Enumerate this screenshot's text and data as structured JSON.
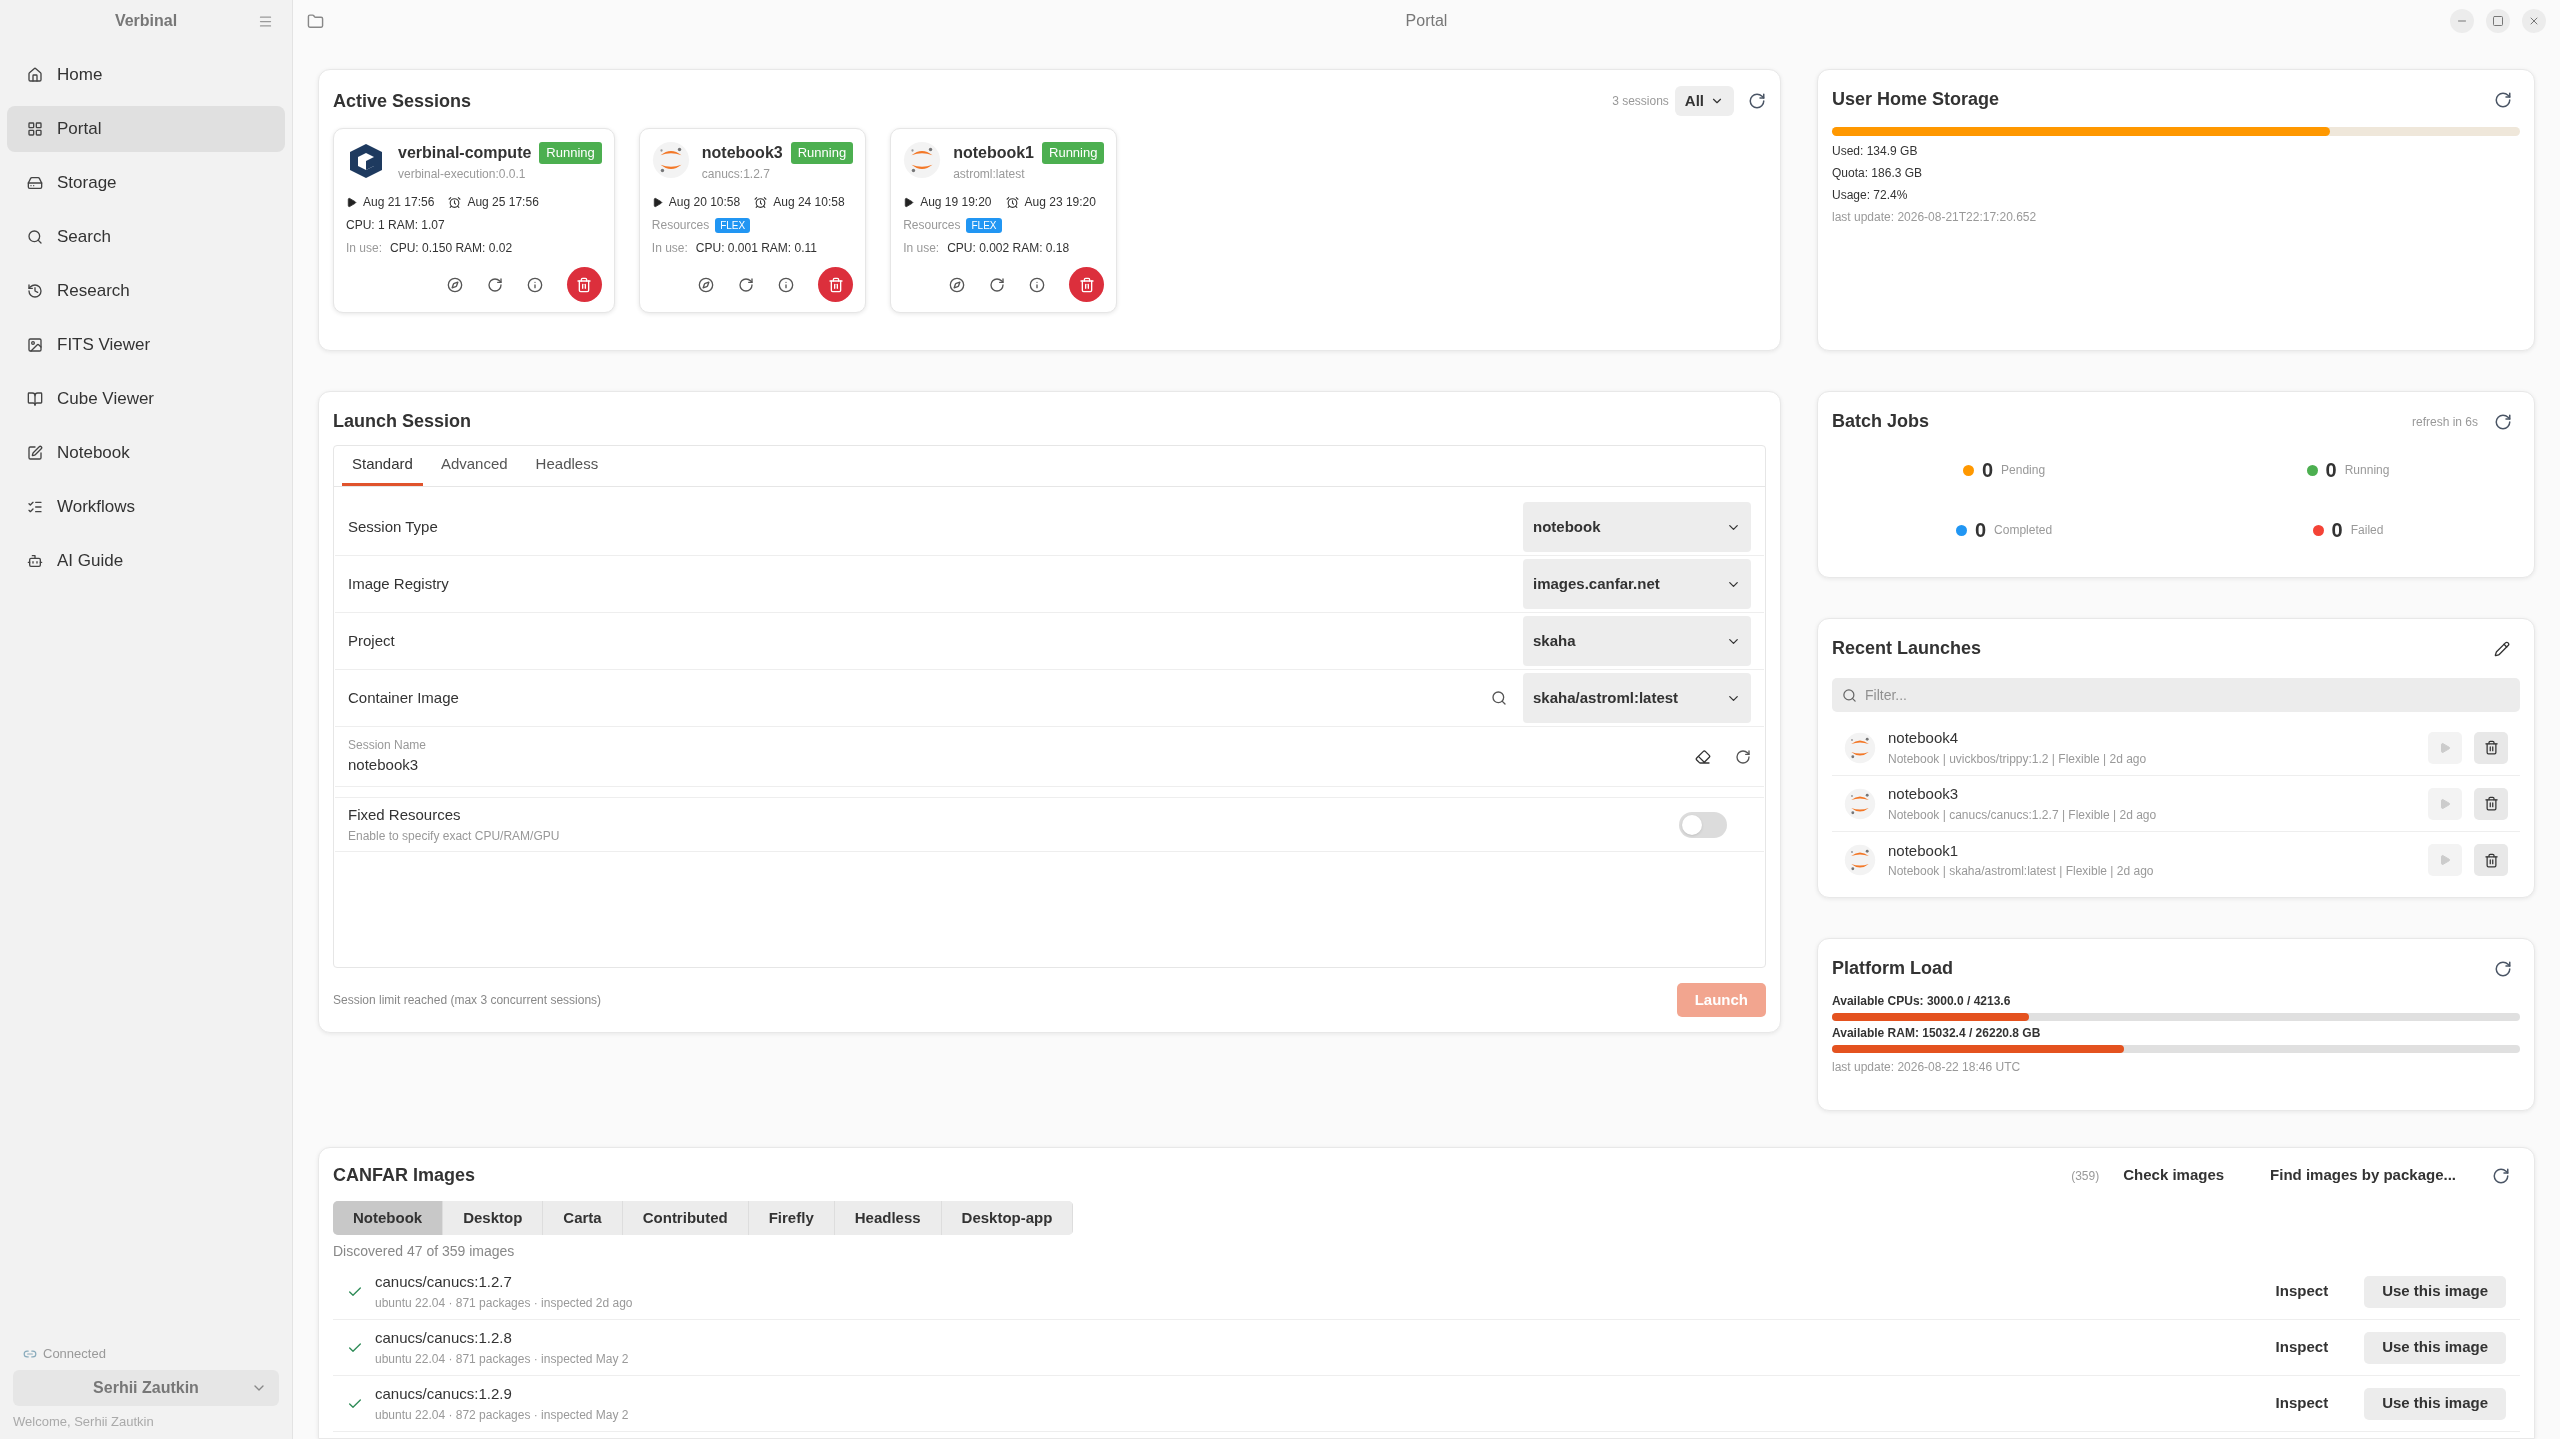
{
  "app": {
    "name": "Verbinal",
    "connection": "Connected",
    "user": "Serhii Zautkin",
    "welcome": "Welcome, Serhii Zautkin"
  },
  "window": {
    "title": "Portal"
  },
  "sidebar": {
    "items": [
      {
        "label": "Home",
        "selected": false
      },
      {
        "label": "Portal",
        "selected": true
      },
      {
        "label": "Storage",
        "selected": false
      },
      {
        "label": "Search",
        "selected": false
      },
      {
        "label": "Research",
        "selected": false
      },
      {
        "label": "FITS Viewer",
        "selected": false
      },
      {
        "label": "Cube Viewer",
        "selected": false
      },
      {
        "label": "Notebook",
        "selected": false
      },
      {
        "label": "Workflows",
        "selected": false
      },
      {
        "label": "AI Guide",
        "selected": false
      }
    ]
  },
  "active_sessions": {
    "title": "Active Sessions",
    "count": "3 sessions",
    "filter": "All",
    "sessions": [
      {
        "name": "verbinal-compute",
        "kind": "cube",
        "status": "Running",
        "image": "verbinal-execution:0.0.1",
        "start": "Aug 21 17:56",
        "end": "Aug 25 17:56",
        "resources": "CPU: 1  RAM: 1.07",
        "usage_label": "In use:",
        "usage": "CPU: 0.150  RAM: 0.02"
      },
      {
        "name": "notebook3",
        "kind": "jupyter",
        "status": "Running",
        "image": "canucs:1.2.7",
        "start": "Aug 20 10:58",
        "end": "Aug 24 10:58",
        "resources_label": "Resources",
        "resources_badge": "FLEX",
        "usage_label": "In use:",
        "usage": "CPU: 0.001  RAM: 0.11"
      },
      {
        "name": "notebook1",
        "kind": "jupyter",
        "status": "Running",
        "image": "astroml:latest",
        "start": "Aug 19 19:20",
        "end": "Aug 23 19:20",
        "resources_label": "Resources",
        "resources_badge": "FLEX",
        "usage_label": "In use:",
        "usage": "CPU: 0.002  RAM: 0.18"
      }
    ]
  },
  "launch_session": {
    "title": "Launch Session",
    "tabs": [
      {
        "label": "Standard",
        "selected": true
      },
      {
        "label": "Advanced",
        "selected": false
      },
      {
        "label": "Headless",
        "selected": false
      }
    ],
    "fields": [
      {
        "label": "Session Type",
        "value": "notebook",
        "kind": "select"
      },
      {
        "label": "Image Registry",
        "value": "images.canfar.net",
        "kind": "select"
      },
      {
        "label": "Project",
        "value": "skaha",
        "kind": "select"
      },
      {
        "label": "Container Image",
        "value": "skaha/astroml:latest",
        "kind": "search"
      }
    ],
    "session_name": {
      "label": "Session Name",
      "value": "notebook3"
    },
    "fixed_resources": {
      "label": "Fixed Resources",
      "hint": "Enable to specify exact CPU/RAM/GPU",
      "on": false
    },
    "limit_note": "Session limit reached (max 3 concurrent sessions)",
    "launch_button": {
      "label": "Launch",
      "disabled": true
    }
  },
  "storage": {
    "title": "User Home Storage",
    "level": 0.724,
    "lines": [
      "Used: 134.9 GB",
      "Quota: 186.3 GB",
      "Usage: 72.4%"
    ],
    "last_update": "last update: 2026-08-21T22:17:20.652"
  },
  "batch_jobs": {
    "title": "Batch Jobs",
    "refresh": "refresh in 6s",
    "counts": [
      {
        "label": "Pending",
        "value": "0",
        "color": "#ff9800"
      },
      {
        "label": "Running",
        "value": "0",
        "color": "#4caf50"
      },
      {
        "label": "Completed",
        "value": "0",
        "color": "#2196f3"
      },
      {
        "label": "Failed",
        "value": "0",
        "color": "#f44336"
      }
    ]
  },
  "recent_launches": {
    "title": "Recent Launches",
    "filter_placeholder": "Filter...",
    "items": [
      {
        "name": "notebook4",
        "details": "Notebook | uvickbos/trippy:1.2 | Flexible | 2d ago"
      },
      {
        "name": "notebook3",
        "details": "Notebook | canucs/canucs:1.2.7 | Flexible | 2d ago"
      },
      {
        "name": "notebook1",
        "details": "Notebook | skaha/astroml:latest | Flexible | 2d ago"
      }
    ]
  },
  "platform_load": {
    "title": "Platform Load",
    "meters": [
      {
        "label": "Available CPUs: 3000.0 / 4213.6",
        "level": 0.287
      },
      {
        "label": "Available RAM: 15032.4 / 26220.8 GB",
        "level": 0.425
      }
    ],
    "last_update": "last update: 2026-08-22 18:46 UTC"
  },
  "canfar_images": {
    "title": "CANFAR Images",
    "count": "(359)",
    "check": "Check images",
    "find": "Find images by package...",
    "tabs": [
      {
        "label": "Notebook",
        "selected": true
      },
      {
        "label": "Desktop",
        "selected": false
      },
      {
        "label": "Carta",
        "selected": false
      },
      {
        "label": "Contributed",
        "selected": false
      },
      {
        "label": "Firefly",
        "selected": false
      },
      {
        "label": "Headless",
        "selected": false
      },
      {
        "label": "Desktop-app",
        "selected": false
      }
    ],
    "summary": "Discovered 47 of 359 images",
    "images": [
      {
        "name": "canucs/canucs:1.2.7",
        "details": "ubuntu 22.04 · 871 packages · inspected 2d ago",
        "inspect": "Inspect",
        "use": "Use this image"
      },
      {
        "name": "canucs/canucs:1.2.8",
        "details": "ubuntu 22.04 · 871 packages · inspected May 2",
        "inspect": "Inspect",
        "use": "Use this image"
      },
      {
        "name": "canucs/canucs:1.2.9",
        "details": "ubuntu 22.04 · 872 packages · inspected May 2",
        "inspect": "Inspect",
        "use": "Use this image"
      }
    ]
  }
}
